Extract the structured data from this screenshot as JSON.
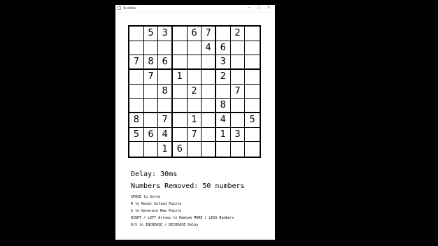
{
  "window": {
    "title": "Sudoku",
    "minimize_glyph": "—",
    "maximize_glyph": "□",
    "close_glyph": "✕"
  },
  "board": [
    [
      "",
      "5",
      "3",
      "",
      "6",
      "7",
      "",
      "2",
      ""
    ],
    [
      "",
      "",
      "",
      "",
      "",
      "4",
      "6",
      "",
      ""
    ],
    [
      "7",
      "8",
      "6",
      "",
      "",
      "",
      "3",
      "",
      ""
    ],
    [
      "",
      "7",
      "",
      "1",
      "",
      "",
      "2",
      "",
      ""
    ],
    [
      "",
      "",
      "8",
      "",
      "2",
      "",
      "",
      "7",
      ""
    ],
    [
      "",
      "",
      "",
      "",
      "",
      "",
      "8",
      "",
      ""
    ],
    [
      "8",
      "",
      "7",
      "",
      "1",
      "",
      "4",
      "",
      "5"
    ],
    [
      "5",
      "6",
      "4",
      "",
      "7",
      "",
      "1",
      "3",
      ""
    ],
    [
      "",
      "",
      "1",
      "6",
      "",
      "",
      "",
      "",
      ""
    ]
  ],
  "status": {
    "delay": "Delay: 30ms",
    "numbers_removed": "Numbers Removed: 50 numbers"
  },
  "help": [
    "SPACE to Solve",
    "R to Reset Solved Puzzle",
    "G to Generate New Puzzle",
    "RIGHT / LEFT Arrows to Remove MORE / LESS Numbers",
    "D/S to INCREASE / DECREASE Delay"
  ]
}
